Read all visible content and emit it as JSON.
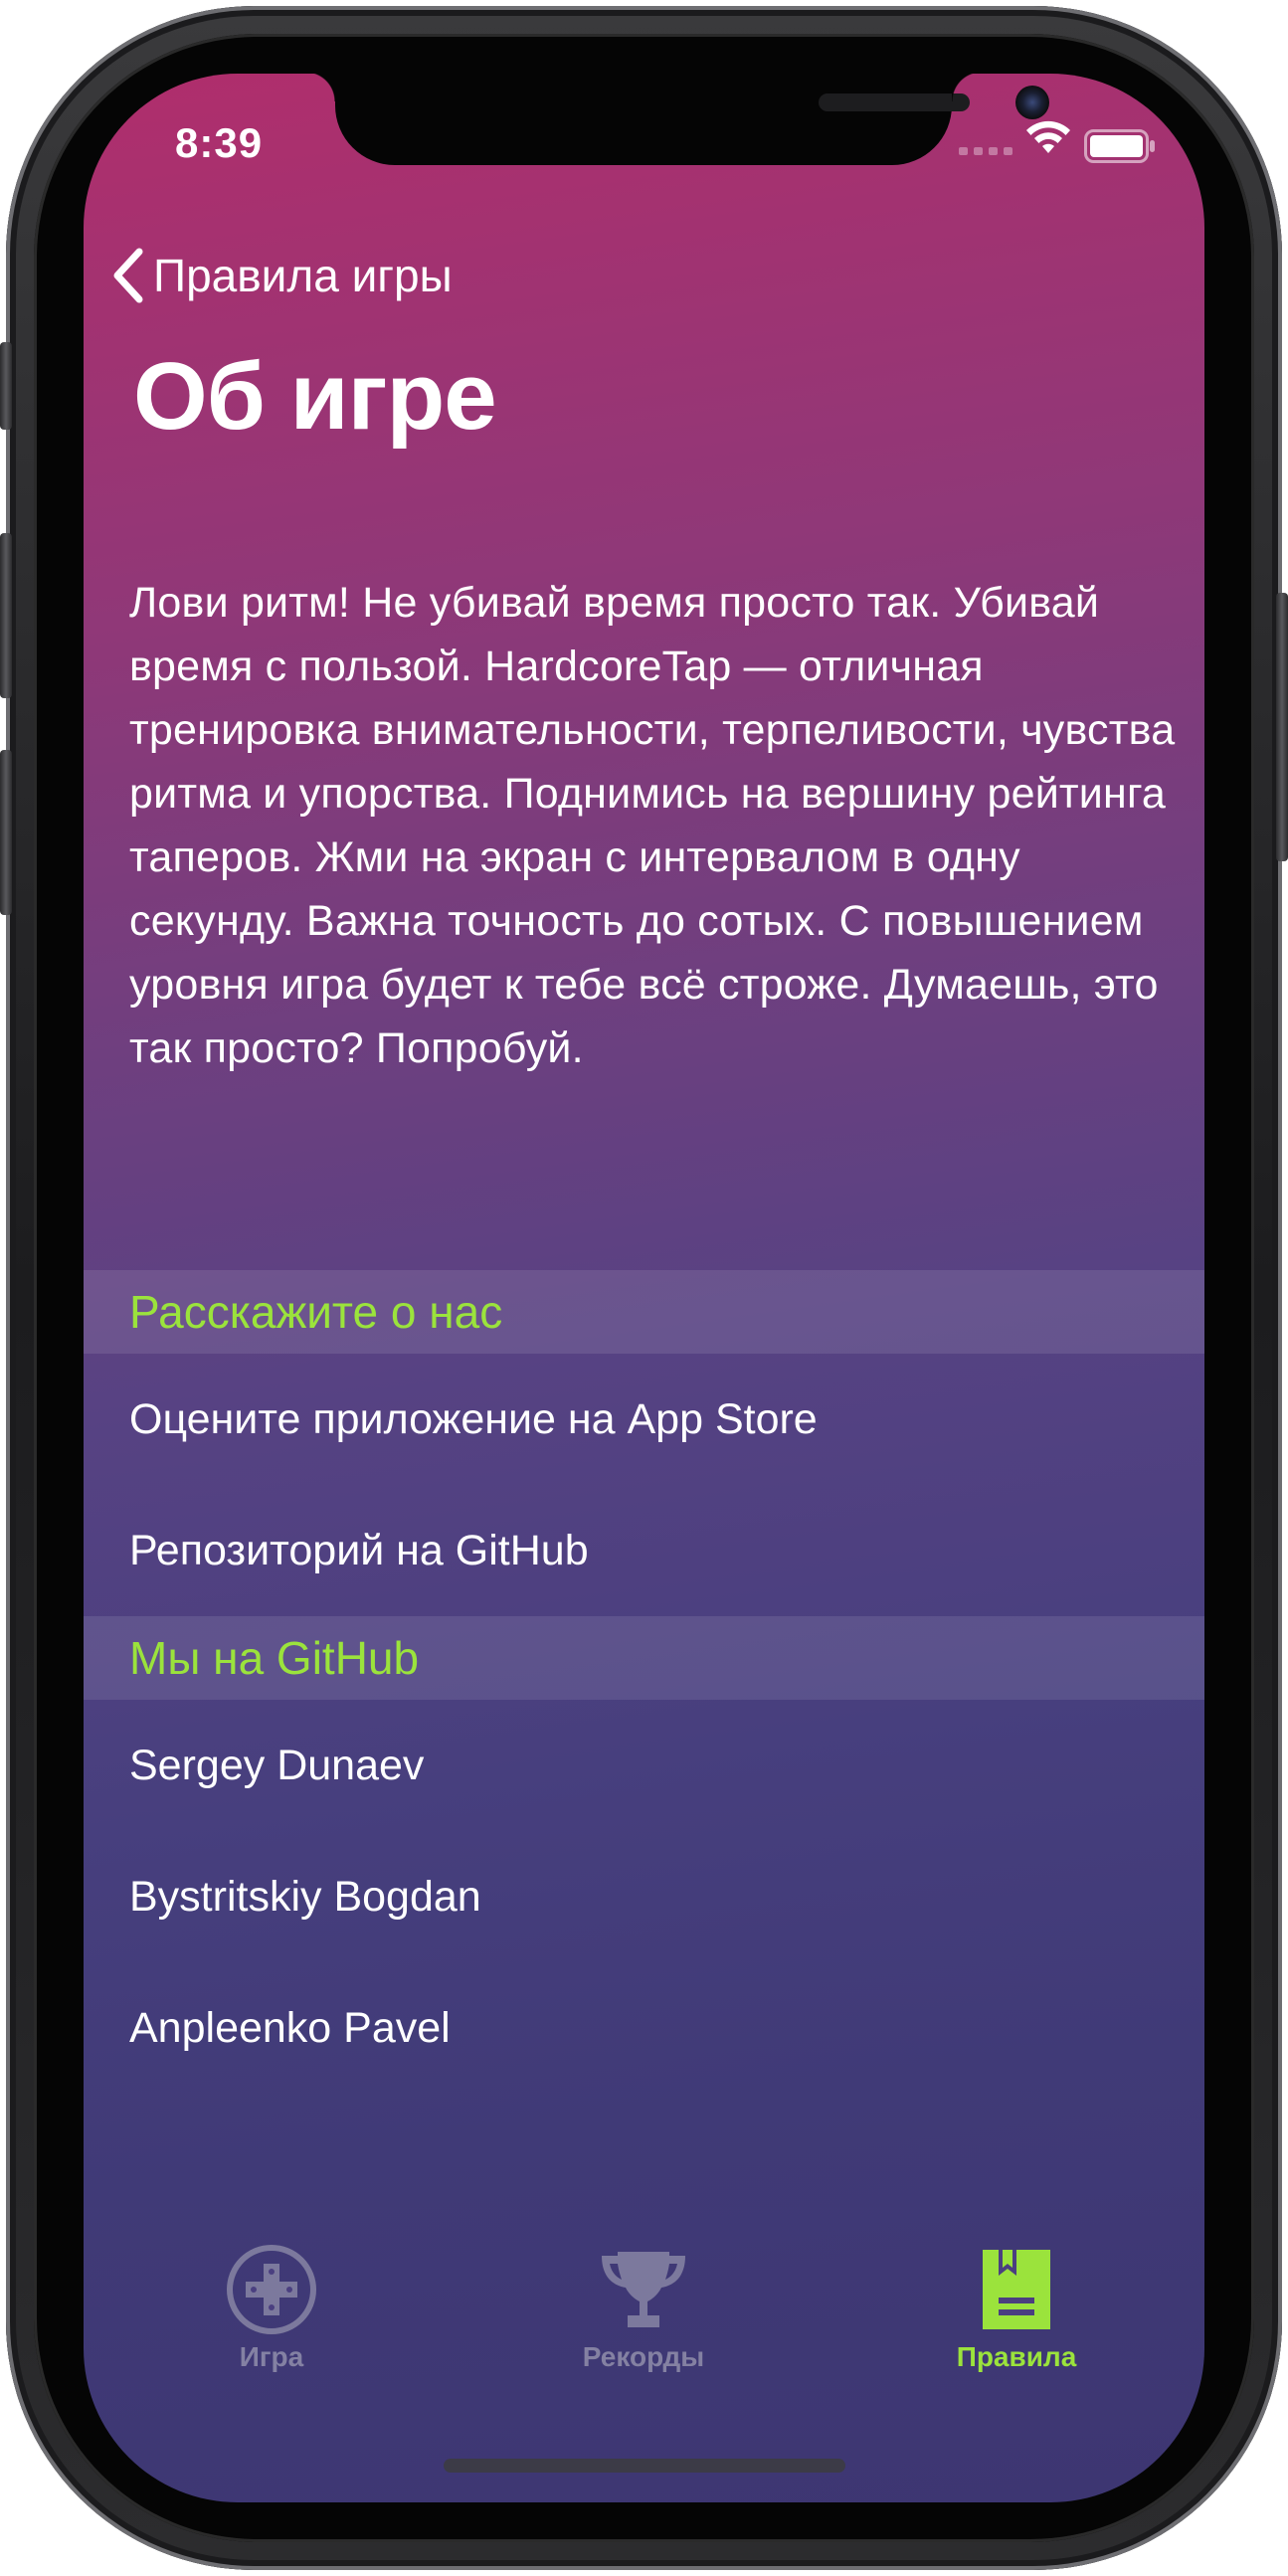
{
  "status_bar": {
    "time": "8:39"
  },
  "nav": {
    "back_label": "Правила игры",
    "title": "Об игре"
  },
  "about": {
    "text": "Лови ритм! Не убивай время просто так. Убивай время с пользой. HardcoreTap  — отличная тренировка внимательности, терпеливости, чувства ритма и упорства. Поднимись на вершину рейтинга таперов. Жми на экран с интервалом в одну секунду. Важна точность до сотых. С повышением уровня игра будет к тебе всё строже. Думаешь, это так просто? Попробуй."
  },
  "sections": [
    {
      "header": "Расскажите о нас",
      "rows": [
        "Оцените приложение на App Store",
        "Репозиторий на GitHub"
      ]
    },
    {
      "header": "Мы на GitHub",
      "rows": [
        "Sergey Dunaev",
        "Bystritskiy Bogdan",
        "Anpleenko Pavel"
      ]
    }
  ],
  "tab_bar": {
    "tabs": [
      {
        "label": "Игра",
        "icon": "gamepad-icon",
        "active": false
      },
      {
        "label": "Рекорды",
        "icon": "trophy-icon",
        "active": false
      },
      {
        "label": "Правила",
        "icon": "book-icon",
        "active": true
      }
    ]
  },
  "colors": {
    "accent": "#9be33c",
    "gradient_top": "#b02e6c",
    "gradient_bottom": "#3d3672"
  }
}
